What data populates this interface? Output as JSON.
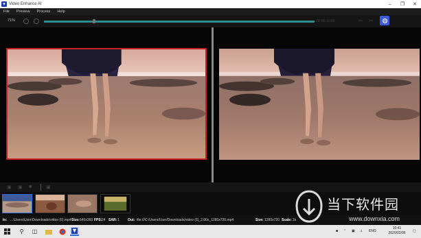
{
  "window": {
    "title": "Video Enhance AI"
  },
  "menu": [
    "File",
    "Preview",
    "Process",
    "Help"
  ],
  "toolbar": {
    "zoom": "71%",
    "timecode": "00:00:10:00",
    "progress": 1.0,
    "playhead": 0.18
  },
  "status": {
    "in_label": "In:",
    "in_path": "...\\Users\\User\\Downloads\\video (6).mp4",
    "in_size_label": "Size:",
    "in_size": "640x360",
    "fps_label": "FPS:",
    "fps": "24",
    "sar_label": "SAR:",
    "sar": "1",
    "out_label": "Out:",
    "out_path": "file:///C:/Users/User/Downloads/video (6)_2.00x_1280x720.mp4",
    "out_size_label": "Size:",
    "out_size": "1280x720",
    "scale_label": "Scale:",
    "scale": "2x"
  },
  "watermark": {
    "brand": "当下软件园",
    "url": "www.downxia.com"
  },
  "taskbar": {
    "time": "10:41",
    "date": "2020/02/06",
    "lang": "ENG"
  },
  "colors": {
    "accent": "#3c5bd9",
    "selection": "#c8201e",
    "progress": "#2a8f8a"
  }
}
